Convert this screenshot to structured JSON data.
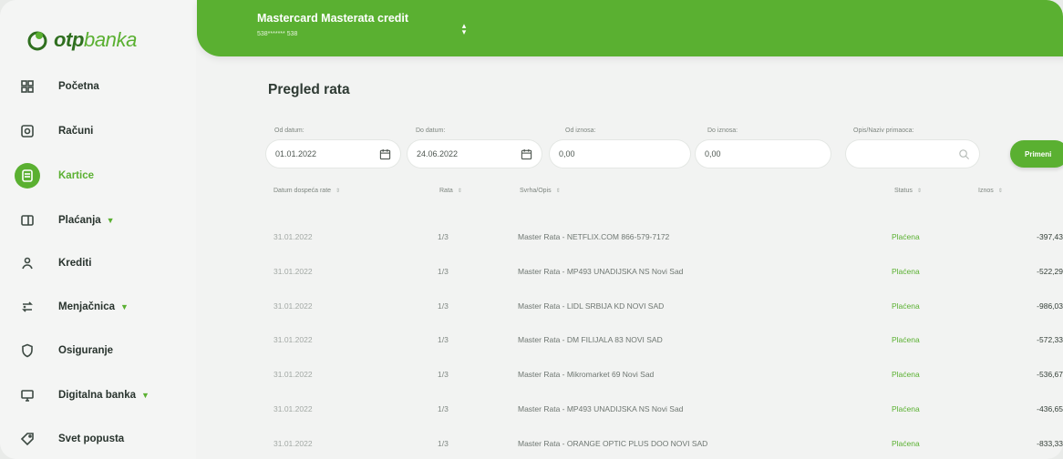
{
  "brand": {
    "logo_text_bold": "otp",
    "logo_text_light": "banka",
    "accent": "#5ab031"
  },
  "sidebar": {
    "items": [
      {
        "label": "Početna",
        "icon": "grid-icon",
        "active": false,
        "has_chevron": false
      },
      {
        "label": "Računi",
        "icon": "account-icon",
        "active": false,
        "has_chevron": false
      },
      {
        "label": "Kartice",
        "icon": "card-icon",
        "active": true,
        "has_chevron": false
      },
      {
        "label": "Plaćanja",
        "icon": "payment-icon",
        "active": false,
        "has_chevron": true
      },
      {
        "label": "Krediti",
        "icon": "loan-icon",
        "active": false,
        "has_chevron": false
      },
      {
        "label": "Menjačnica",
        "icon": "exchange-icon",
        "active": false,
        "has_chevron": true
      },
      {
        "label": "Osiguranje",
        "icon": "shield-icon",
        "active": false,
        "has_chevron": false
      },
      {
        "label": "Digitalna banka",
        "icon": "monitor-icon",
        "active": false,
        "has_chevron": true
      },
      {
        "label": "Svet popusta",
        "icon": "tag-icon",
        "active": false,
        "has_chevron": false
      }
    ]
  },
  "header": {
    "card_title": "Mastercard Masterata credit",
    "card_number": "538******* 538"
  },
  "main": {
    "title": "Pregled rata",
    "filters": {
      "from_date_label": "Od datum:",
      "from_date_value": "01.01.2022",
      "to_date_label": "Do datum:",
      "to_date_value": "24.06.2022",
      "from_amount_label": "Od iznosa:",
      "from_amount_value": "0,00",
      "to_amount_label": "Do iznosa:",
      "to_amount_value": "0,00",
      "search_label": "Opis/Naziv primaoca:",
      "search_value": "",
      "apply_label": "Primeni"
    },
    "table": {
      "headers": {
        "due_date": "Datum dospeća rate",
        "rate": "Rata",
        "description": "Svrha/Opis",
        "status": "Status",
        "amount": "Iznos"
      },
      "rows": [
        {
          "date": "31.01.2022",
          "rate": "1/3",
          "description": "Master Rata - NETFLIX.COM 866-579-7172",
          "status": "Plaćena",
          "amount": "-397,43"
        },
        {
          "date": "31.01.2022",
          "rate": "1/3",
          "description": "Master Rata - MP493 UNADIJSKA NS Novi Sad",
          "status": "Plaćena",
          "amount": "-522,29"
        },
        {
          "date": "31.01.2022",
          "rate": "1/3",
          "description": "Master Rata - LIDL SRBIJA KD NOVI SAD",
          "status": "Plaćena",
          "amount": "-986,03"
        },
        {
          "date": "31.01.2022",
          "rate": "1/3",
          "description": "Master Rata - DM FILIJALA 83 NOVI SAD",
          "status": "Plaćena",
          "amount": "-572,33"
        },
        {
          "date": "31.01.2022",
          "rate": "1/3",
          "description": "Master Rata - Mikromarket 69 Novi Sad",
          "status": "Plaćena",
          "amount": "-536,67"
        },
        {
          "date": "31.01.2022",
          "rate": "1/3",
          "description": "Master Rata - MP493 UNADIJSKA NS Novi Sad",
          "status": "Plaćena",
          "amount": "-436,65"
        },
        {
          "date": "31.01.2022",
          "rate": "1/3",
          "description": "Master Rata - ORANGE OPTIC PLUS DOO NOVI SAD",
          "status": "Plaćena",
          "amount": "-833,33"
        }
      ]
    }
  }
}
